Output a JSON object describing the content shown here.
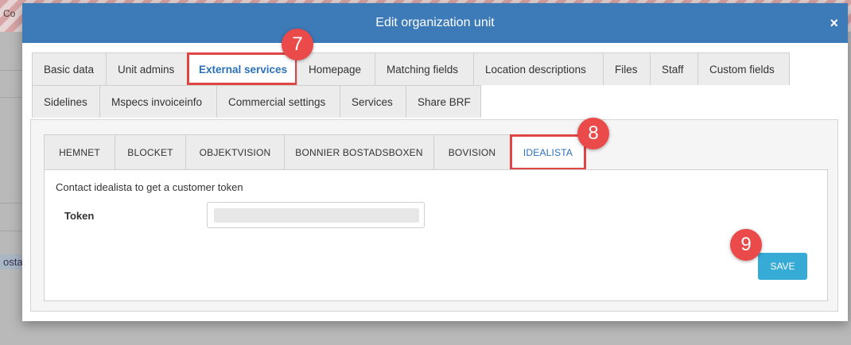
{
  "background": {
    "fragment_top": "Co",
    "fragment_link": "osta)"
  },
  "modal": {
    "title": "Edit organization unit",
    "close_label": "×",
    "header_color": "#3c7ab8"
  },
  "outer_tabs": {
    "row1": [
      {
        "label": "Basic data"
      },
      {
        "label": "Unit admins"
      },
      {
        "label": "External services",
        "active": true
      },
      {
        "label": "Homepage"
      },
      {
        "label": "Matching fields"
      },
      {
        "label": "Location descriptions"
      },
      {
        "label": "Files"
      },
      {
        "label": "Staff"
      },
      {
        "label": "Custom fields"
      }
    ],
    "row2": [
      {
        "label": "Sidelines"
      },
      {
        "label": "Mspecs invoiceinfo"
      },
      {
        "label": "Commercial settings"
      },
      {
        "label": "Services"
      },
      {
        "label": "Share BRF"
      }
    ]
  },
  "inner_tabs": [
    {
      "label": "HEMNET"
    },
    {
      "label": "BLOCKET"
    },
    {
      "label": "OBJEKTVISION"
    },
    {
      "label": "BONNIER BOSTADSBOXEN"
    },
    {
      "label": "BOVISION"
    },
    {
      "label": "IDEALISTA",
      "active": true
    }
  ],
  "idealista": {
    "hint": "Contact idealista to get a customer token",
    "token_label": "Token",
    "token_value": "",
    "save_label": "SAVE"
  },
  "annotations": {
    "badge_7": "7",
    "badge_8": "8",
    "badge_9": "9",
    "color": "#ea4a4a"
  }
}
